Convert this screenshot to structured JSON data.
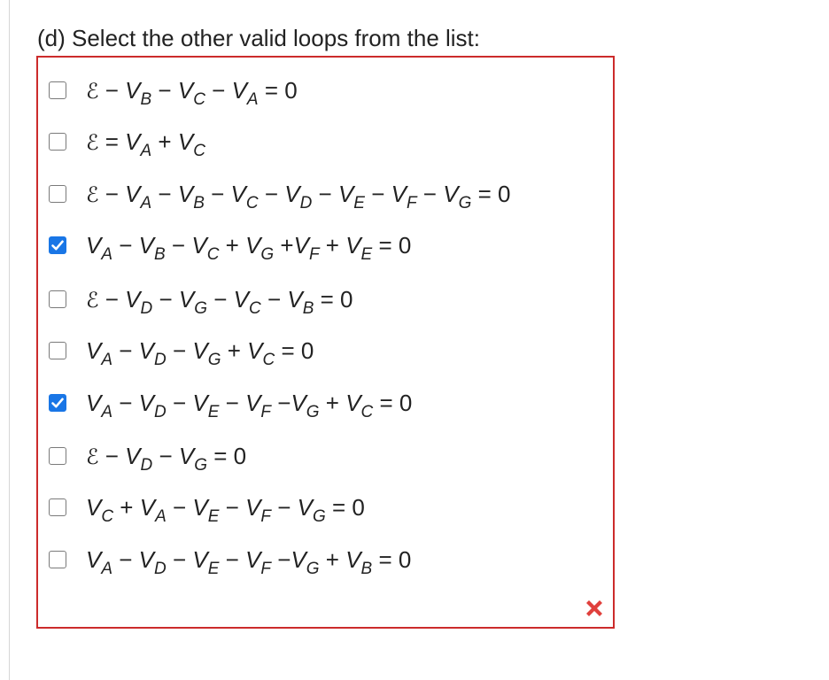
{
  "question": {
    "label": "(d) Select the other valid loops from the list:"
  },
  "colors": {
    "box_border": "#cc2b2b",
    "checkbox_checked": "#1976e6",
    "incorrect_mark": "#e0403c"
  },
  "options": [
    {
      "text": "ℰ − V_B − V_C − V_A = 0",
      "checked": false
    },
    {
      "text": "ℰ = V_A + V_C",
      "checked": false
    },
    {
      "text": "ℰ − V_A − V_B − V_C − V_D − V_E − V_F − V_G = 0",
      "checked": false
    },
    {
      "text": "V_A − V_B − V_C + V_G +V_F + V_E = 0",
      "checked": true
    },
    {
      "text": "ℰ − V_D − V_G − V_C − V_B = 0",
      "checked": false
    },
    {
      "text": "V_A − V_D − V_G + V_C = 0",
      "checked": false
    },
    {
      "text": "V_A − V_D − V_E − V_F −V_G + V_C = 0",
      "checked": true
    },
    {
      "text": "ℰ − V_D − V_G = 0",
      "checked": false
    },
    {
      "text": "V_C + V_A − V_E − V_F − V_G = 0",
      "checked": false
    },
    {
      "text": "V_A − V_D − V_E − V_F −V_G + V_B = 0",
      "checked": false
    }
  ],
  "status_icon": "incorrect-x-icon"
}
